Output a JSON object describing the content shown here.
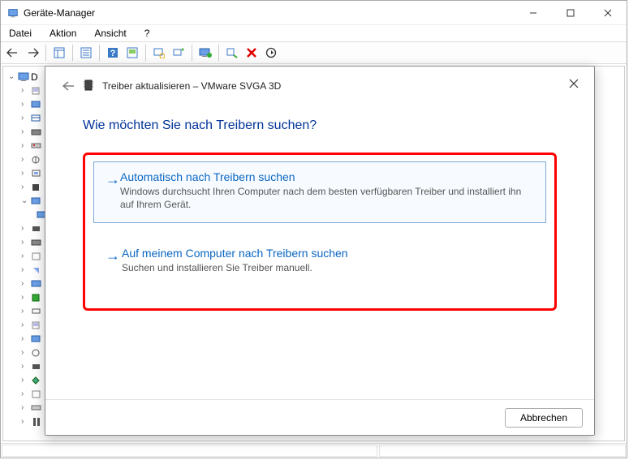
{
  "window": {
    "title": "Geräte-Manager"
  },
  "menubar": {
    "file": "Datei",
    "action": "Aktion",
    "view": "Ansicht",
    "help": "?"
  },
  "tree": {
    "root_label": "D"
  },
  "dialog": {
    "title": "Treiber aktualisieren – VMware SVGA 3D",
    "question": "Wie möchten Sie nach Treibern suchen?",
    "option1_title": "Automatisch nach Treibern suchen",
    "option1_desc": "Windows durchsucht Ihren Computer nach dem besten verfügbaren Treiber und installiert ihn auf Ihrem Gerät.",
    "option2_title": "Auf meinem Computer nach Treibern suchen",
    "option2_desc": "Suchen und installieren Sie Treiber manuell.",
    "cancel": "Abbrechen"
  }
}
